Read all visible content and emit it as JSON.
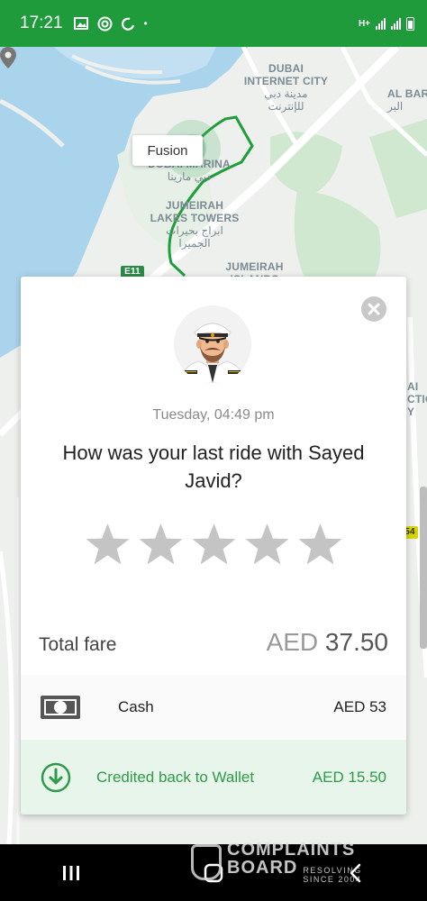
{
  "status_bar": {
    "time": "17:21",
    "network": "H+"
  },
  "map": {
    "labels": {
      "internet_city_en": "DUBAI\nINTERNET CITY",
      "internet_city_ar": "مدينة دبي\nللإنترنت",
      "al_barsha": "AL BAR",
      "al_barsha_ar": "البر",
      "marina_en": "DUBAI MARINA",
      "marina_ar": "دبي مارينا",
      "jlt_en": "JUMEIRAH\nLAKES TOWERS",
      "jlt_ar": "ابراج بحيرات\nالجميرا",
      "jumeirah_islands_en": "JUMEIRAH\nISLANDS",
      "road_e11": "E11",
      "right_edge_1": "AI\nCTIO\nY",
      "right_edge_2": "54"
    },
    "pickup_tag": "Fusion",
    "route_color": "#1e9e3a"
  },
  "rating_card": {
    "ride_datetime": "Tuesday, 04:49 pm",
    "question": "How was your last ride with Sayed Javid?",
    "stars_total": 5,
    "stars_selected": 0,
    "star_color": "#c4c4c4",
    "fare_label": "Total fare",
    "fare_currency": "AED",
    "fare_amount": "37.50",
    "payment_method": "Cash",
    "payment_amount": "AED 53",
    "wallet_label": "Credited back to Wallet",
    "wallet_amount": "AED 15.50",
    "accent_color": "#2e9b4a"
  },
  "watermark": {
    "line1": "COMPLAINTS",
    "line2": "BOARD",
    "tagline_1": "RESOLVING",
    "tagline_2": "SINCE 2004"
  },
  "icons": {
    "close": "close-icon",
    "avatar": "driver-avatar",
    "star": "star-icon",
    "cash": "cash-icon",
    "wallet": "download-circle-icon",
    "nav_recents": "recents-icon",
    "nav_home": "home-icon",
    "nav_back": "back-icon"
  }
}
